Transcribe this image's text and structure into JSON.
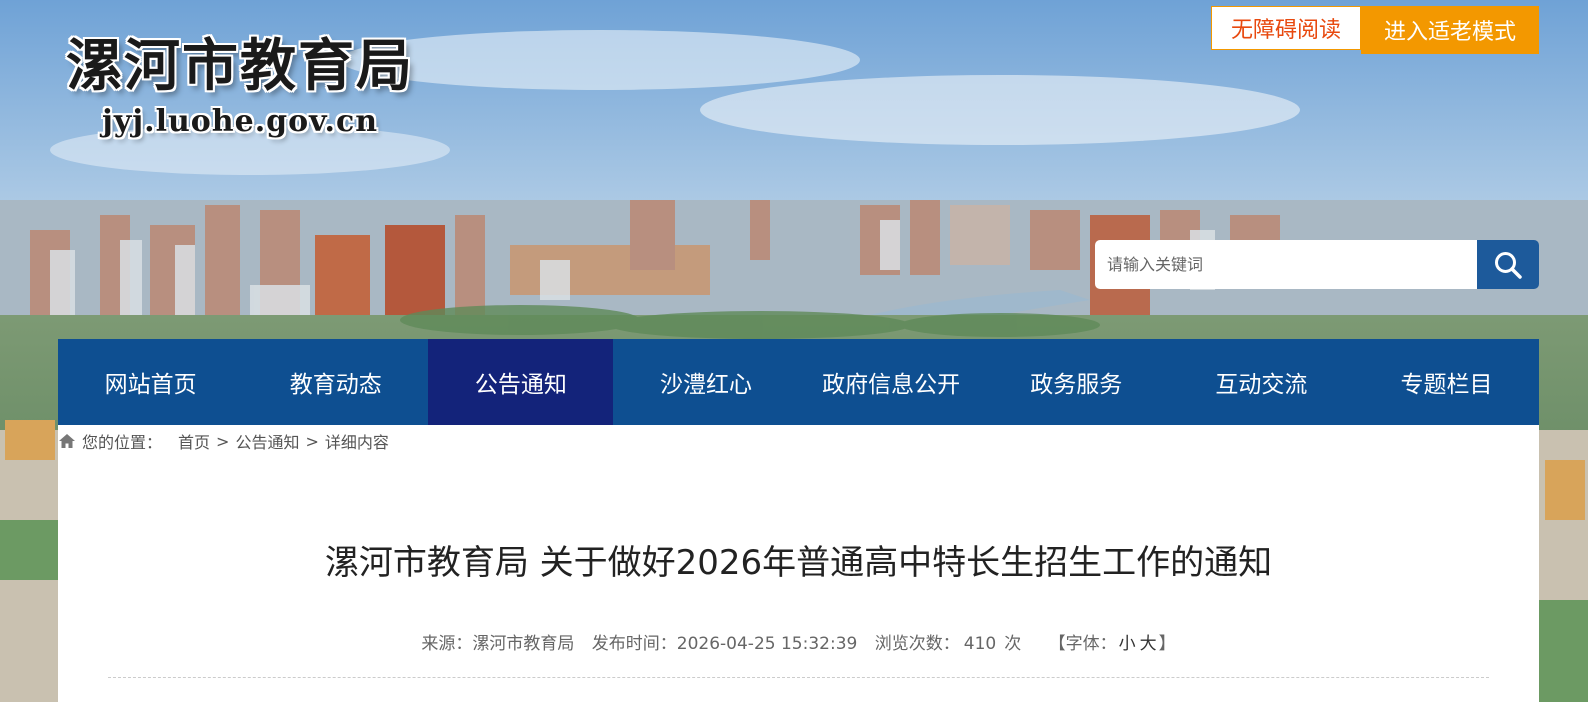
{
  "header": {
    "site_name": "漯河市教育局",
    "domain": "jyj.luohe.gov.cn",
    "accessible_label": "无障碍阅读",
    "elder_mode_label": "进入适老模式"
  },
  "search": {
    "placeholder": "请输入关键词",
    "icon": "search-icon"
  },
  "nav": {
    "items": [
      "网站首页",
      "教育动态",
      "公告通知",
      "沙澧红心",
      "政府信息公开",
      "政务服务",
      "互动交流",
      "专题栏目"
    ],
    "active_index": 2
  },
  "breadcrumb": {
    "prefix": "您的位置：",
    "items": [
      "首页",
      "公告通知",
      "详细内容"
    ],
    "separator": ">"
  },
  "article": {
    "title": "漯河市教育局 关于做好2026年普通高中特长生招生工作的通知",
    "source_label": "来源：",
    "source": "漯河市教育局",
    "time_label": "发布时间：",
    "time": "2026-04-25 15:32:39",
    "views_label": "浏览次数：",
    "views": "410",
    "views_unit": "次",
    "font_label": "【字体：",
    "font_small": "小",
    "font_large": "大",
    "font_close": "】"
  },
  "colors": {
    "nav_bg": "#0e4f91",
    "nav_active": "#13237a",
    "accent_orange": "#f39800",
    "search_btn": "#1d5a9b"
  }
}
